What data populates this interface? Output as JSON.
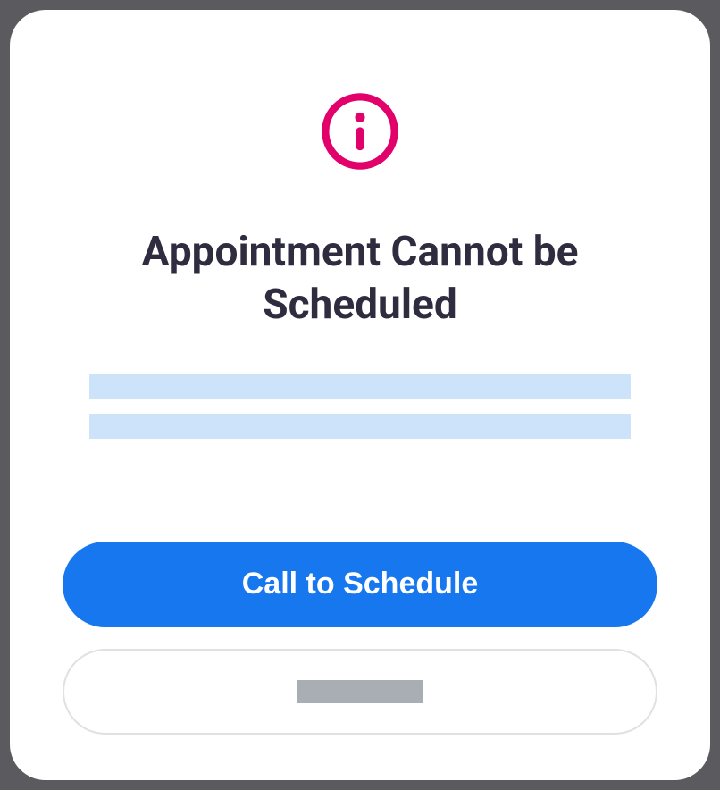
{
  "dialog": {
    "icon": "info-icon",
    "title": "Appointment Cannot be Scheduled",
    "primary_button_label": "Call to Schedule",
    "colors": {
      "accent": "#e2006a",
      "primary_button": "#1677ee",
      "placeholder": "#cde3fa",
      "title_text": "#302c3f"
    }
  }
}
